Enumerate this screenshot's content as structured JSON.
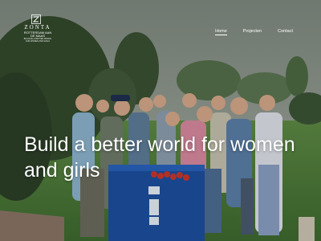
{
  "logo": {
    "brand": "ZONTA",
    "club": "ROTTERDAM AAN DE MAAS",
    "tagline": "BUILDING A BETTER WORLD FOR WOMEN AND GIRLS"
  },
  "nav": {
    "items": [
      {
        "label": "Home",
        "active": true
      },
      {
        "label": "Projecten",
        "active": false
      },
      {
        "label": "Contact",
        "active": false
      }
    ]
  },
  "hero": {
    "headline": "Build a better world for women and girls",
    "accent_crate": "#1d4fa0",
    "accent_grass": "#4f7a3a"
  }
}
